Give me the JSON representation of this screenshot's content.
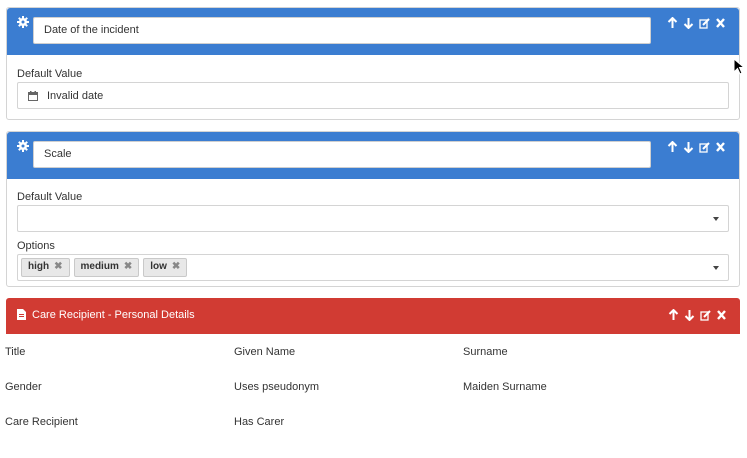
{
  "colors": {
    "blue_header": "#3b7dd1",
    "red_header": "#d13b33"
  },
  "icons": {
    "settings": "gear-icon",
    "move_up": "arrow-up-icon",
    "move_down": "arrow-down-icon",
    "edit": "edit-icon",
    "remove": "close-icon",
    "date": "calendar-icon",
    "form": "file-icon",
    "dropdown": "chevron-down-icon",
    "remove_tag": "close-icon"
  },
  "field_date": {
    "name_value": "Date of the incident",
    "default_label": "Default Value",
    "default_value": "Invalid date"
  },
  "field_scale": {
    "name_value": "Scale",
    "default_label": "Default Value",
    "default_value": "",
    "options_label": "Options",
    "options": [
      {
        "label": "high",
        "remove": "✖"
      },
      {
        "label": "medium",
        "remove": "✖"
      },
      {
        "label": "low",
        "remove": "✖"
      }
    ]
  },
  "section": {
    "title": "Care Recipient - Personal Details",
    "fields": [
      "Title",
      "Given Name",
      "Surname",
      "Gender",
      "Uses pseudonym",
      "Maiden Surname",
      "Care Recipient",
      "Has Carer"
    ]
  }
}
